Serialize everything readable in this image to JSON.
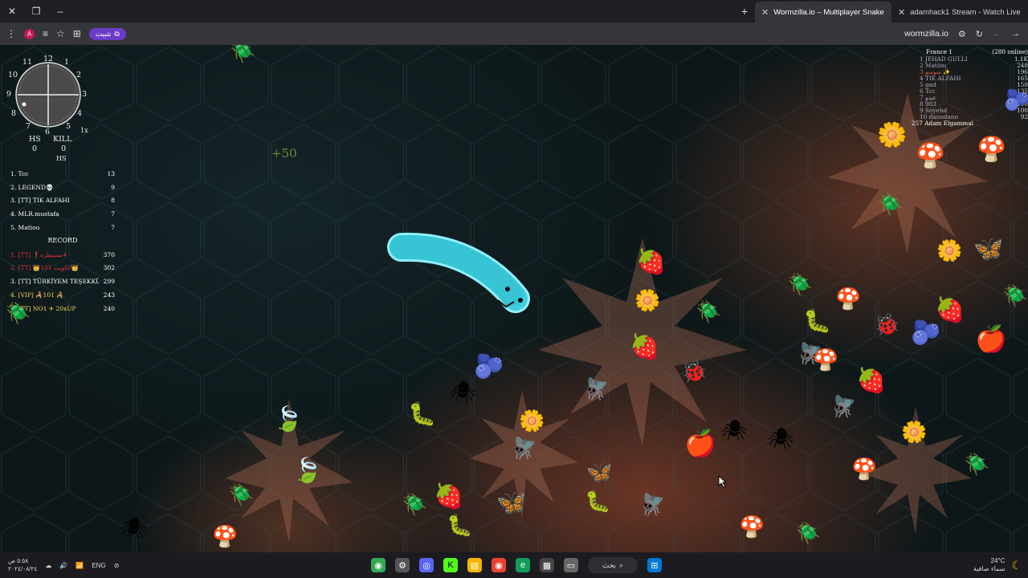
{
  "browser": {
    "tabs": [
      {
        "title": "Wormzilla.io – Multiplayer Snake",
        "active": true
      },
      {
        "title": "adamhack1 Stream - Watch Live",
        "active": false
      }
    ],
    "url": "wormzilla.io",
    "install_label": "تثبيت",
    "profile_initial": "A"
  },
  "hud": {
    "compass_numbers": [
      "12",
      "1",
      "2",
      "3",
      "4",
      "5",
      "6",
      "7",
      "8",
      "9",
      "10",
      "11"
    ],
    "zoom": "1x",
    "hs_label": "HS",
    "kill_label": "KILL",
    "hs_value": "0",
    "kill_value": "0",
    "hs_label2": "HS",
    "float_text": "+50"
  },
  "leaderboard_left": {
    "top": [
      {
        "rank": "1.",
        "name": "Tcc",
        "score": "13"
      },
      {
        "rank": "2.",
        "name": "LEGEND💀",
        "score": "9"
      },
      {
        "rank": "3.",
        "name": "[TT] TIK ALFAHI",
        "score": "8"
      },
      {
        "rank": "4.",
        "name": "MLR.mustafa",
        "score": "7"
      },
      {
        "rank": "5.",
        "name": "Matiou",
        "score": "7"
      }
    ],
    "record_title": "RECORD",
    "record": [
      {
        "rank": "1.",
        "name": "[TT] ❗مسيطرة✈",
        "score": "370"
      },
      {
        "rank": "2.",
        "name": "[TT] 👑101 الكويت👑",
        "score": "302"
      },
      {
        "rank": "3.",
        "name": "[TT] TÜRKİYEM TEŞEKKÜR",
        "score": "299"
      },
      {
        "rank": "4.",
        "name": "[VIP] 🦂101 🦂",
        "score": "243"
      },
      {
        "rank": "5.",
        "name": "[TT] NO1 ✈ 20xUP",
        "score": "240"
      }
    ]
  },
  "leaderboard_right": {
    "server": "France 1",
    "online": "(280 online)",
    "rows": [
      {
        "rank": "1",
        "name": "JEHAD GULLI",
        "score": "1.1K"
      },
      {
        "rank": "2",
        "name": "Matiou",
        "score": "248"
      },
      {
        "rank": "3",
        "name": "سوسو ✨",
        "score": "196"
      },
      {
        "rank": "4",
        "name": "TIK ALFAHI",
        "score": "165"
      },
      {
        "rank": "5",
        "name": "gad",
        "score": "150"
      },
      {
        "rank": "6",
        "name": "Tcc",
        "score": "135"
      },
      {
        "rank": "7",
        "name": "عبدو",
        "score": "120"
      },
      {
        "rank": "8",
        "name": "983",
        "score": "110"
      },
      {
        "rank": "9",
        "name": "Soyehd",
        "score": "100"
      },
      {
        "rank": "10",
        "name": "danodano",
        "score": "92"
      }
    ],
    "me": {
      "rank": "257",
      "name": "Adam Elgammal",
      "score": ""
    }
  },
  "taskbar": {
    "time": "٥:٥٨ ص",
    "date": "٢٠٢٤/٠٨/٢٤",
    "lang": "ENG",
    "search_label": "بحث",
    "temp": "24°C",
    "weather": "سماء صافية"
  },
  "colors": {
    "worm": "#3fd0e0",
    "worm_outline": "#8ff0ff",
    "install_button": "#6a3cc9"
  }
}
